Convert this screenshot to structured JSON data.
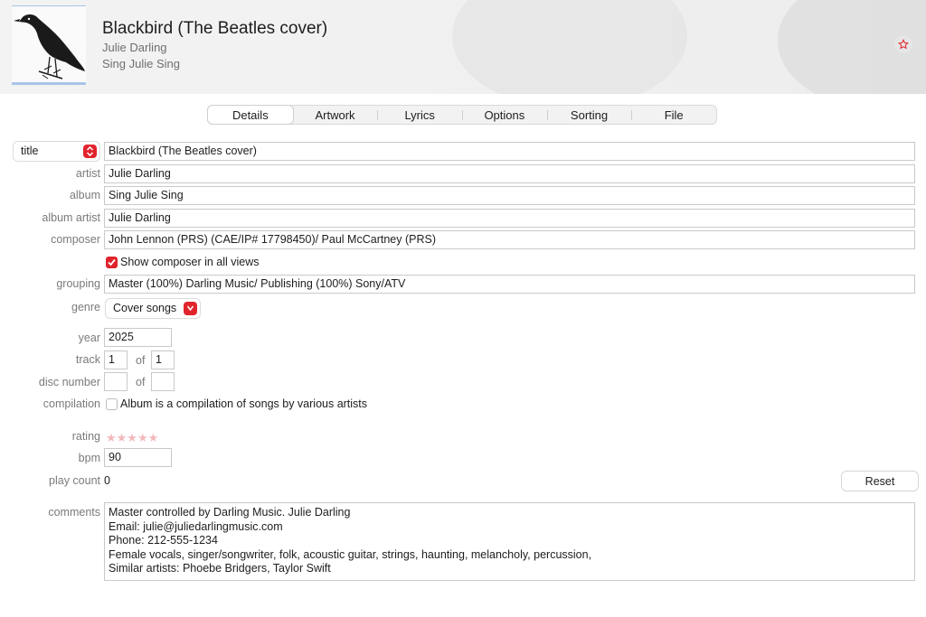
{
  "header": {
    "title": "Blackbird (The Beatles cover)",
    "artist": "Julie Darling",
    "album": "Sing Julie Sing",
    "artwork_icon": "blackbird-artwork",
    "love_icon": "star-icon"
  },
  "tabs": [
    {
      "label": "Details",
      "active": true
    },
    {
      "label": "Artwork"
    },
    {
      "label": "Lyrics"
    },
    {
      "label": "Options"
    },
    {
      "label": "Sorting"
    },
    {
      "label": "File"
    }
  ],
  "fields": {
    "title_selector": "title",
    "title": "Blackbird (The Beatles cover)",
    "artist_label": "artist",
    "artist": "Julie Darling",
    "album_label": "album",
    "album": "Sing Julie Sing",
    "album_artist_label": "album artist",
    "album_artist": "Julie Darling",
    "composer_label": "composer",
    "composer": "John Lennon (PRS) (CAE/IP# 17798450)/ Paul McCartney (PRS)",
    "show_composer_text": "Show composer in all views",
    "show_composer_checked": true,
    "grouping_label": "grouping",
    "grouping": "Master (100%) Darling Music/ Publishing (100%) Sony/ATV",
    "genre_label": "genre",
    "genre": "Cover songs",
    "year_label": "year",
    "year": "2025",
    "track_label": "track",
    "track": "1",
    "track_of": "1",
    "of_label": "of",
    "disc_label": "disc number",
    "disc": "",
    "disc_of": "",
    "compilation_label": "compilation",
    "compilation_text": "Album is a compilation of songs by various artists",
    "compilation_checked": false,
    "rating_label": "rating",
    "rating": 0,
    "rating_stars": "★★★★★",
    "bpm_label": "bpm",
    "bpm": "90",
    "play_count_label": "play count",
    "play_count": "0",
    "reset_label": "Reset",
    "comments_label": "comments",
    "comments": "Master controlled by Darling Music. Julie Darling\nEmail: julie@juliedarlingmusic.com\nPhone: 212-555-1234\nFemale vocals, singer/songwriter, folk, acoustic guitar, strings, haunting, melancholy, percussion,\nSimilar artists: Phoebe Bridgers, Taylor Swift"
  },
  "colors": {
    "accent": "#e0242d",
    "rating_empty": "#f2b9bc"
  }
}
